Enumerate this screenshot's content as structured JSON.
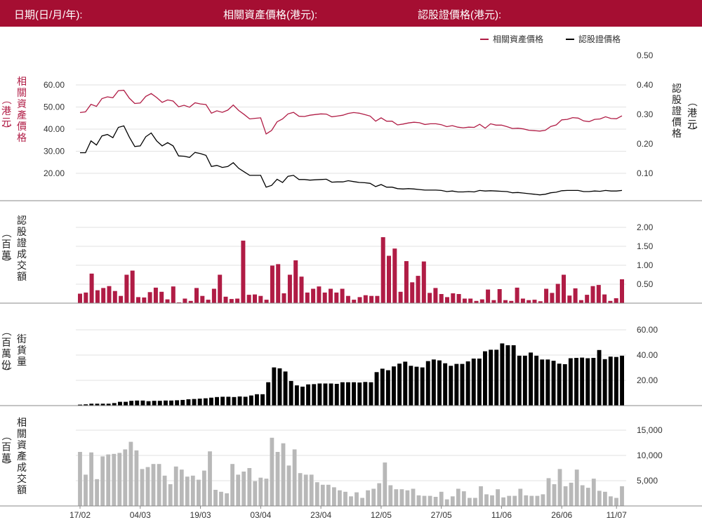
{
  "header": {
    "date_label": "日期(日/月/年):",
    "underlying_label": "相關資產價格(港元):",
    "warrant_label": "認股證價格(港元):"
  },
  "colors": {
    "brand": "#a50e32",
    "underlying": "#b01c45",
    "warrant": "#000000",
    "turnover_bar": "#b01c45",
    "outstanding_bar": "#000000",
    "underlying_turnover_bar": "#b8b8b8"
  },
  "chart_data": [
    {
      "type": "line",
      "panel": "price",
      "legend_position": "top-right",
      "left_axis_label": "相關資產價格（港元）",
      "right_axis_label": "認股證價格（港元）",
      "left_ylim": [
        10,
        62
      ],
      "left_ticks": [
        "20.00",
        "30.00",
        "40.00",
        "50.00",
        "60.00"
      ],
      "right_ylim": [
        0.025,
        0.525
      ],
      "right_ticks": [
        "0.10",
        "0.20",
        "0.30",
        "0.40",
        "0.50"
      ],
      "series": [
        {
          "name": "相關資產價格",
          "axis": "left",
          "values": [
            47.5,
            47.8,
            51.2,
            50.3,
            53.8,
            54.6,
            54.2,
            57.4,
            57.6,
            54.0,
            51.6,
            51.8,
            54.8,
            56.1,
            54.3,
            52.1,
            53.2,
            52.7,
            50.1,
            50.8,
            49.9,
            51.9,
            51.4,
            51.1,
            47.2,
            48.3,
            47.6,
            48.6,
            50.9,
            48.4,
            46.6,
            44.6,
            44.9,
            45.1,
            37.8,
            39.4,
            43.3,
            44.6,
            46.9,
            47.6,
            45.8,
            45.7,
            46.3,
            46.6,
            46.9,
            46.8,
            45.6,
            45.9,
            46.3,
            47.1,
            47.5,
            47.2,
            46.6,
            45.9,
            43.6,
            45.1,
            43.6,
            43.6,
            41.9,
            42.3,
            42.8,
            43.1,
            42.9,
            42.1,
            42.4,
            42.4,
            42.0,
            41.1,
            41.6,
            40.9,
            40.6,
            40.9,
            40.8,
            42.2,
            40.4,
            42.4,
            41.8,
            41.8,
            41.1,
            40.3,
            40.4,
            40.1,
            39.5,
            39.3,
            39.1,
            39.5,
            41.2,
            41.9,
            44.2,
            44.4,
            45.2,
            45.0,
            43.7,
            43.4,
            44.4,
            44.6,
            45.6,
            44.8,
            44.7,
            46.0
          ]
        },
        {
          "name": "認股證價格",
          "axis": "right",
          "values": [
            0.17,
            0.17,
            0.21,
            0.196,
            0.227,
            0.232,
            0.221,
            0.256,
            0.261,
            0.223,
            0.191,
            0.193,
            0.224,
            0.237,
            0.21,
            0.193,
            0.204,
            0.193,
            0.159,
            0.158,
            0.154,
            0.171,
            0.167,
            0.161,
            0.123,
            0.127,
            0.12,
            0.123,
            0.136,
            0.117,
            0.105,
            0.093,
            0.093,
            0.093,
            0.053,
            0.059,
            0.08,
            0.069,
            0.09,
            0.093,
            0.079,
            0.079,
            0.077,
            0.078,
            0.079,
            0.08,
            0.07,
            0.071,
            0.071,
            0.075,
            0.072,
            0.069,
            0.068,
            0.066,
            0.055,
            0.062,
            0.053,
            0.053,
            0.048,
            0.047,
            0.048,
            0.047,
            0.045,
            0.043,
            0.043,
            0.043,
            0.042,
            0.038,
            0.04,
            0.037,
            0.037,
            0.038,
            0.037,
            0.042,
            0.04,
            0.041,
            0.04,
            0.039,
            0.038,
            0.034,
            0.035,
            0.033,
            0.031,
            0.029,
            0.027,
            0.029,
            0.034,
            0.036,
            0.041,
            0.042,
            0.042,
            0.042,
            0.038,
            0.038,
            0.04,
            0.039,
            0.042,
            0.04,
            0.04,
            0.042
          ]
        }
      ]
    },
    {
      "type": "bar",
      "panel": "warrant_turnover",
      "axis_label": "認股證成交額（百萬）",
      "ylim": [
        0,
        2.2
      ],
      "ticks": [
        "0.50",
        "1.00",
        "1.50",
        "2.00"
      ],
      "values": [
        0.25,
        0.28,
        0.78,
        0.34,
        0.4,
        0.45,
        0.32,
        0.19,
        0.75,
        0.86,
        0.16,
        0.15,
        0.29,
        0.41,
        0.3,
        0.1,
        0.44,
        0.02,
        0.12,
        0.06,
        0.4,
        0.19,
        0.09,
        0.38,
        0.75,
        0.17,
        0.11,
        0.12,
        1.65,
        0.22,
        0.23,
        0.19,
        0.09,
        0.99,
        1.03,
        0.26,
        0.75,
        1.13,
        0.7,
        0.28,
        0.38,
        0.44,
        0.28,
        0.38,
        0.28,
        0.38,
        0.19,
        0.09,
        0.16,
        0.21,
        0.19,
        0.19,
        1.74,
        1.25,
        1.44,
        0.3,
        1.11,
        0.55,
        0.72,
        1.1,
        0.27,
        0.4,
        0.24,
        0.16,
        0.26,
        0.24,
        0.12,
        0.12,
        0.06,
        0.1,
        0.36,
        0.08,
        0.37,
        0.08,
        0.06,
        0.41,
        0.12,
        0.08,
        0.09,
        0.05,
        0.38,
        0.27,
        0.51,
        0.75,
        0.2,
        0.39,
        0.08,
        0.22,
        0.45,
        0.48,
        0.23,
        0.06,
        0.13,
        0.63
      ]
    },
    {
      "type": "bar",
      "panel": "outstanding",
      "axis_label": "街貨量（百萬份）",
      "ylim": [
        0,
        65
      ],
      "ticks": [
        "20.00",
        "40.00",
        "60.00"
      ],
      "values": [
        0.8,
        1.0,
        1.5,
        1.5,
        1.5,
        1.5,
        2.0,
        3.0,
        3.0,
        3.8,
        4.0,
        4.0,
        3.5,
        3.8,
        3.8,
        4.0,
        4.0,
        4.2,
        4.5,
        5.0,
        5.2,
        5.5,
        5.8,
        6.3,
        6.8,
        7.0,
        7.0,
        6.8,
        7.2,
        7.0,
        8.0,
        9.0,
        9.0,
        18.5,
        30.2,
        29.5,
        27.0,
        19.5,
        16.0,
        15.0,
        16.8,
        17.0,
        17.5,
        17.5,
        17.5,
        17.2,
        18.5,
        18.5,
        18.5,
        18.3,
        18.7,
        18.5,
        26.5,
        29.2,
        28.0,
        31.0,
        33.2,
        34.8,
        31.5,
        30.8,
        30.2,
        35.2,
        36.5,
        35.8,
        33.5,
        31.5,
        33.0,
        33.0,
        35.0,
        37.2,
        37.2,
        43.0,
        44.2,
        44.2,
        49.2,
        47.8,
        47.8,
        39.5,
        39.5,
        42.0,
        39.5,
        36.5,
        36.5,
        35.5,
        33.2,
        32.8,
        37.5,
        37.8,
        38.0,
        37.5,
        37.8,
        44.0,
        36.8,
        38.8,
        38.5,
        39.5
      ]
    },
    {
      "type": "bar",
      "panel": "underlying_turnover",
      "axis_label": "相關資產成交額（百萬）",
      "ylim": [
        0,
        17000
      ],
      "ticks": [
        "5,000",
        "10,000",
        "15,000"
      ],
      "values": [
        10700,
        6200,
        10600,
        5300,
        9800,
        10200,
        10300,
        10500,
        11200,
        12700,
        11000,
        7300,
        7700,
        8300,
        8300,
        6000,
        4300,
        7800,
        7200,
        5800,
        6000,
        5200,
        7000,
        10800,
        3200,
        2800,
        2500,
        8300,
        6200,
        6800,
        7500,
        4900,
        5600,
        5400,
        13500,
        10700,
        12400,
        8000,
        11200,
        6500,
        6200,
        6200,
        4700,
        4200,
        4200,
        3700,
        3100,
        2800,
        1900,
        2700,
        1600,
        3100,
        3400,
        4500,
        8600,
        4100,
        3300,
        3300,
        3100,
        3400,
        2100,
        2000,
        2000,
        1800,
        2800,
        1300,
        1900,
        3400,
        2900,
        1600,
        1600,
        3900,
        2300,
        2100,
        3300,
        1700,
        2000,
        2000,
        3400,
        2100,
        2000,
        2000,
        2300,
        5500,
        4300,
        7300,
        3900,
        4600,
        7200,
        4100,
        3600,
        5400,
        3000,
        2800,
        1900,
        1600,
        3900
      ]
    }
  ],
  "x_axis": {
    "ticks": [
      {
        "label": "17/02",
        "index": 0
      },
      {
        "label": "04/03",
        "index": 11
      },
      {
        "label": "19/03",
        "index": 22
      },
      {
        "label": "03/04",
        "index": 33
      },
      {
        "label": "23/04",
        "index": 44
      },
      {
        "label": "12/05",
        "index": 55
      },
      {
        "label": "27/05",
        "index": 66
      },
      {
        "label": "11/06",
        "index": 77
      },
      {
        "label": "26/06",
        "index": 88
      },
      {
        "label": "11/07",
        "index": 98
      }
    ]
  }
}
